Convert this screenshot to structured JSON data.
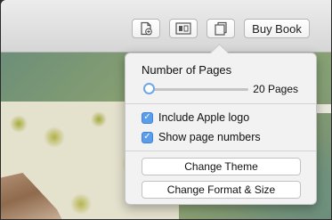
{
  "toolbar": {
    "buy_label": "Buy Book"
  },
  "popover": {
    "title": "Number of Pages",
    "slider_value": 0,
    "pages_label": "20 Pages",
    "checkboxes": [
      {
        "label": "Include Apple logo",
        "checked": true
      },
      {
        "label": "Show page numbers",
        "checked": true
      }
    ],
    "buttons": [
      {
        "label": "Change Theme"
      },
      {
        "label": "Change Format & Size"
      }
    ]
  },
  "colors": {
    "accent": "#5a9dea"
  }
}
